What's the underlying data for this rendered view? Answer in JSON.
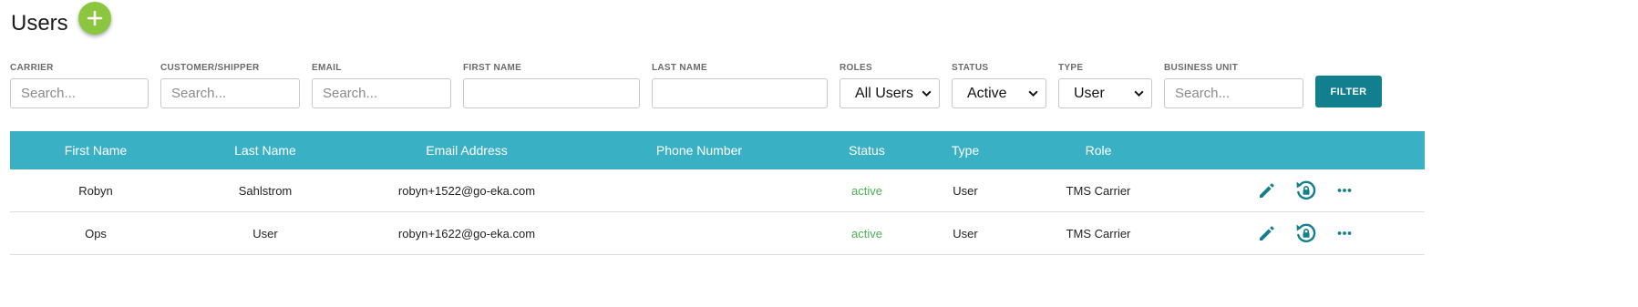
{
  "header": {
    "title": "Users",
    "add_icon": "plus-icon",
    "add_color": "#8cc63f"
  },
  "filters": {
    "carrier": {
      "label": "CARRIER",
      "placeholder": "Search...",
      "value": ""
    },
    "customer": {
      "label": "CUSTOMER/SHIPPER",
      "placeholder": "Search...",
      "value": ""
    },
    "email": {
      "label": "EMAIL",
      "placeholder": "Search...",
      "value": ""
    },
    "first_name": {
      "label": "FIRST NAME",
      "placeholder": "",
      "value": ""
    },
    "last_name": {
      "label": "LAST NAME",
      "placeholder": "",
      "value": ""
    },
    "roles": {
      "label": "ROLES",
      "selected": "All Users"
    },
    "status": {
      "label": "STATUS",
      "selected": "Active"
    },
    "type": {
      "label": "TYPE",
      "selected": "User"
    },
    "business_unit": {
      "label": "BUSINESS UNIT",
      "placeholder": "Search...",
      "value": ""
    },
    "filter_button": "FILTER"
  },
  "table": {
    "header_color": "#3ab0c4",
    "columns": [
      "First Name",
      "Last Name",
      "Email Address",
      "Phone Number",
      "Status",
      "Type",
      "Role"
    ],
    "rows": [
      {
        "first_name": "Robyn",
        "last_name": "Sahlstrom",
        "email": "robyn+1522@go-eka.com",
        "phone": "",
        "status": "active",
        "type": "User",
        "role": "TMS Carrier"
      },
      {
        "first_name": "Ops",
        "last_name": "User",
        "email": "robyn+1622@go-eka.com",
        "phone": "",
        "status": "active",
        "type": "User",
        "role": "TMS Carrier"
      }
    ],
    "row_actions": [
      "pencil-icon",
      "reset-password-lock-icon",
      "more-horizontal-icon"
    ]
  },
  "colors": {
    "accent": "#127f8e",
    "status_active": "#4caf50"
  }
}
